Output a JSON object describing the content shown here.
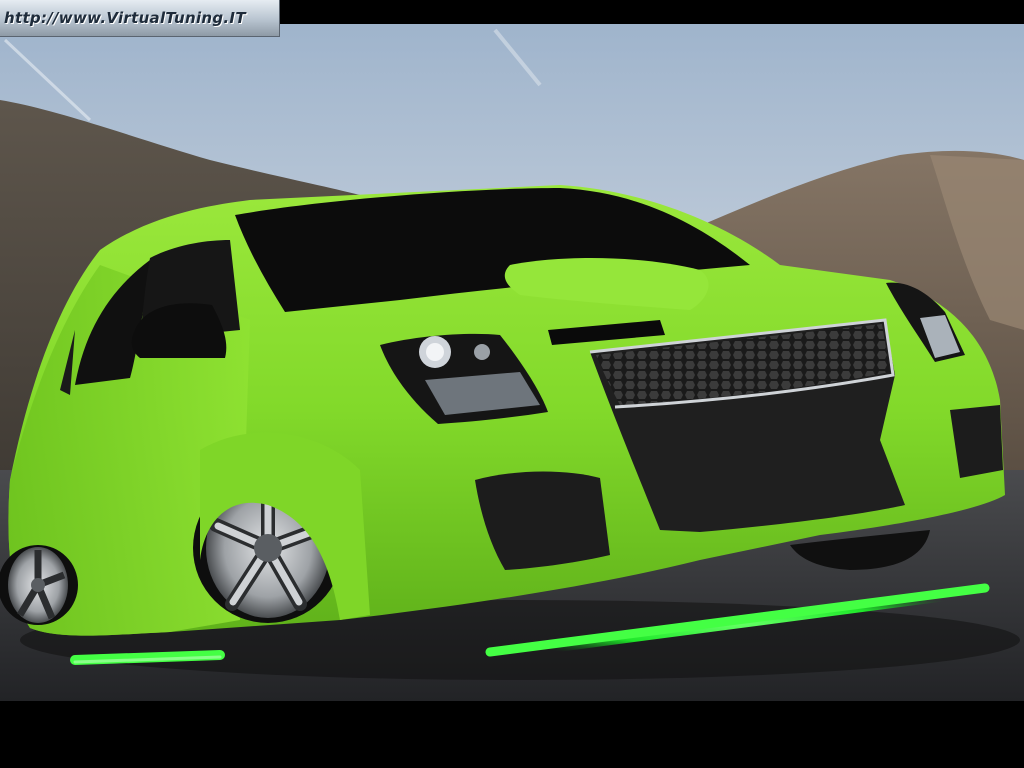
{
  "watermark": {
    "text": "http://www.VirtualTuning.IT"
  },
  "colors": {
    "car_body": "#86dd2c",
    "neon_underglow": "#33ff3a",
    "sky": "#d6dde6",
    "road": "#2c2d30"
  }
}
